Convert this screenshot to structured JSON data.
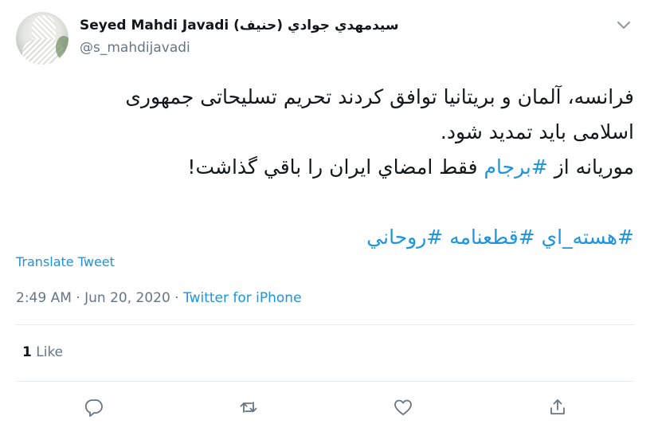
{
  "author": {
    "display_name": "Seyed Mahdi Javadi (سیدمهدي جوادي (حنيف",
    "handle": "@s_mahdijavadi"
  },
  "tweet": {
    "line1": "فرانسه، آلمان و بریتانیا توافق کردند تحریم تسلیحاتی جمهوری",
    "line2": "اسلامی باید تمدید شود.",
    "line3_prefix": "موريانه از ",
    "line3_hashtag": "#برجام",
    "line3_suffix": " فقط امضاي ايران را باقي گذاشت!",
    "hashtags": [
      "#هسته_اي",
      "#قطعنامه",
      "#روحاني"
    ]
  },
  "translate_label": "Translate Tweet",
  "meta": {
    "time": "2:49 AM",
    "separator": " · ",
    "date": "Jun 20, 2020",
    "source": "Twitter for iPhone"
  },
  "stats": {
    "likes_count": "1",
    "likes_label": "Like"
  },
  "actions": {
    "reply_icon": "reply-icon",
    "retweet_icon": "retweet-icon",
    "like_icon": "heart-icon",
    "share_icon": "share-icon"
  },
  "colors": {
    "link": "#1b95e0",
    "muted": "#657786",
    "text": "#14171a",
    "divider": "#e6ecf0"
  }
}
